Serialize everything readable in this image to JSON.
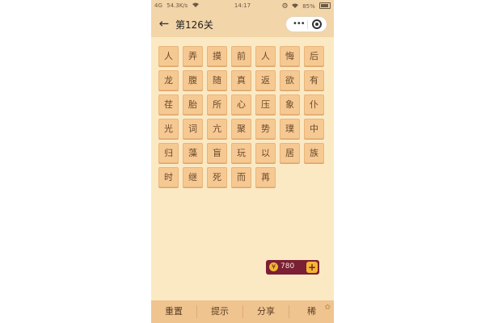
{
  "status_bar": {
    "network": "4G",
    "speed": "54.3K/s",
    "wifi_icon": "wifi-icon",
    "time": "14:17",
    "alarm_icon": "alarm-icon",
    "battery": "85%",
    "battery_level": 0.85
  },
  "title_bar": {
    "back_icon": "back-arrow-icon",
    "title": "第126关",
    "more_label": "•••",
    "close_icon": "target-icon"
  },
  "grid": {
    "rows": [
      [
        "人",
        "弄",
        "摸",
        "前",
        "人",
        "悔",
        "后"
      ],
      [
        "龙",
        "腹",
        "随",
        "真",
        "返",
        "欲",
        "有"
      ],
      [
        "荏",
        "胎",
        "所",
        "心",
        "压",
        "象",
        "仆"
      ],
      [
        "光",
        "词",
        "亢",
        "聚",
        "势",
        "璞",
        "中"
      ],
      [
        "归",
        "藻",
        "盲",
        "玩",
        "以",
        "居",
        "族"
      ],
      [
        "时",
        "继",
        "死",
        "而",
        "苒"
      ]
    ]
  },
  "coins": {
    "value": "780",
    "plus": "+"
  },
  "bottom_bar": {
    "reset": "重置",
    "hint": "提示",
    "share": "分享",
    "last": "稀"
  },
  "colors": {
    "background": "#fbe9c3",
    "header": "#f2d5a8",
    "tile": "#f6c993",
    "tile_text": "#6a4a2c",
    "coin_badge": "#7a1f34",
    "coin_gold": "#f2b632",
    "bottom_bar": "#f0c48f"
  }
}
